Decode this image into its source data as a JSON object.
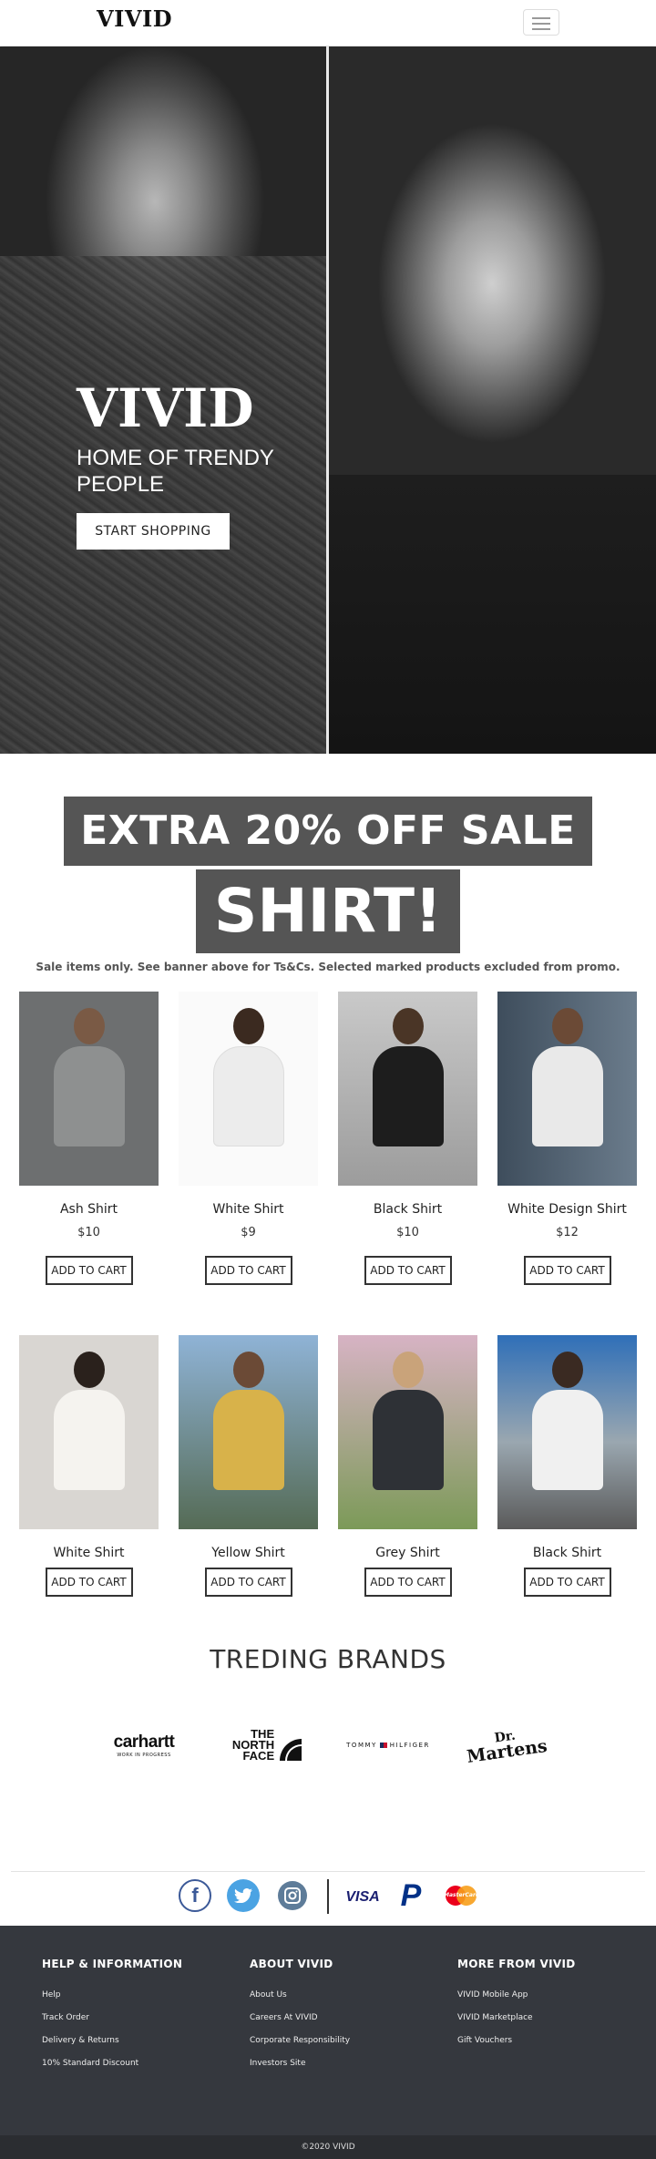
{
  "nav": {
    "logo": "VIVID",
    "menu_icon": "hamburger-menu-icon"
  },
  "hero": {
    "title": "VIVID",
    "subtitle": "HOME OF TRENDY PEOPLE",
    "cta_label": "START SHOPPING"
  },
  "sale": {
    "line1": "EXTRA 20% OFF SALE",
    "line2": "SHIRT!",
    "note": "Sale items only. See banner above for Ts&Cs. Selected marked products excluded from promo."
  },
  "products_row1": [
    {
      "name": "Ash Shirt",
      "price": "$10",
      "button": "ADD TO CART",
      "shirt_color": "#8e9090",
      "bg": "#6d6f70"
    },
    {
      "name": "White Shirt",
      "price": "$9",
      "button": "ADD TO CART",
      "shirt_color": "#f2f2f2",
      "bg": "#ffffff"
    },
    {
      "name": "Black Shirt",
      "price": "$10",
      "button": "ADD TO CART",
      "shirt_color": "#1d1d1d",
      "bg": "#b7b7b7"
    },
    {
      "name": "White Design Shirt",
      "price": "$12",
      "button": "ADD TO CART",
      "shirt_color": "#e9e9e9",
      "bg": "#4a5a6a"
    }
  ],
  "products_row2": [
    {
      "name": "White Shirt",
      "button": "ADD TO CART",
      "shirt_color": "#f5f3ef",
      "bg": "#d9d6d2"
    },
    {
      "name": "Yellow Shirt",
      "button": "ADD TO CART",
      "shirt_color": "#d8b24a",
      "bg": "#7fa3c8"
    },
    {
      "name": "Grey Shirt",
      "button": "ADD TO CART",
      "shirt_color": "#2e3136",
      "bg": "#c9a3b5"
    },
    {
      "name": "Black Shirt",
      "button": "ADD TO CART",
      "shirt_color": "#f0f0f0",
      "bg": "#6a86ab"
    }
  ],
  "brands": {
    "title": "TREDING BRANDS",
    "items": [
      "carhartt",
      "WORK IN PROGRESS",
      "THE",
      "NORTH",
      "FACE",
      "TOMMY",
      "HILFIGER",
      "Dr.",
      "Martens"
    ]
  },
  "social": {
    "icons": [
      "facebook-icon",
      "twitter-icon",
      "instagram-icon",
      "visa-icon",
      "paypal-icon",
      "mastercard-icon"
    ],
    "visa_text": "VISA",
    "paypal_text": "P",
    "mastercard_text": "MasterCard"
  },
  "footer": {
    "col1": {
      "title": "HELP & INFORMATION",
      "links": [
        "Help",
        "Track Order",
        "Delivery & Returns",
        "10% Standard Discount"
      ]
    },
    "col2": {
      "title": "ABOUT VIVID",
      "links": [
        "About Us",
        "Careers At VIVID",
        "Corporate Responsibility",
        "Investors Site"
      ]
    },
    "col3": {
      "title": "MORE FROM VIVID",
      "links": [
        "VIVID Mobile App",
        "VIVID Marketplace",
        "Gift Vouchers"
      ]
    },
    "copyright": "©2020 VIVID"
  },
  "colors": {
    "sale_bg": "#555555",
    "footer_bg": "#35383e",
    "copyright_bg": "#2b2d31"
  }
}
